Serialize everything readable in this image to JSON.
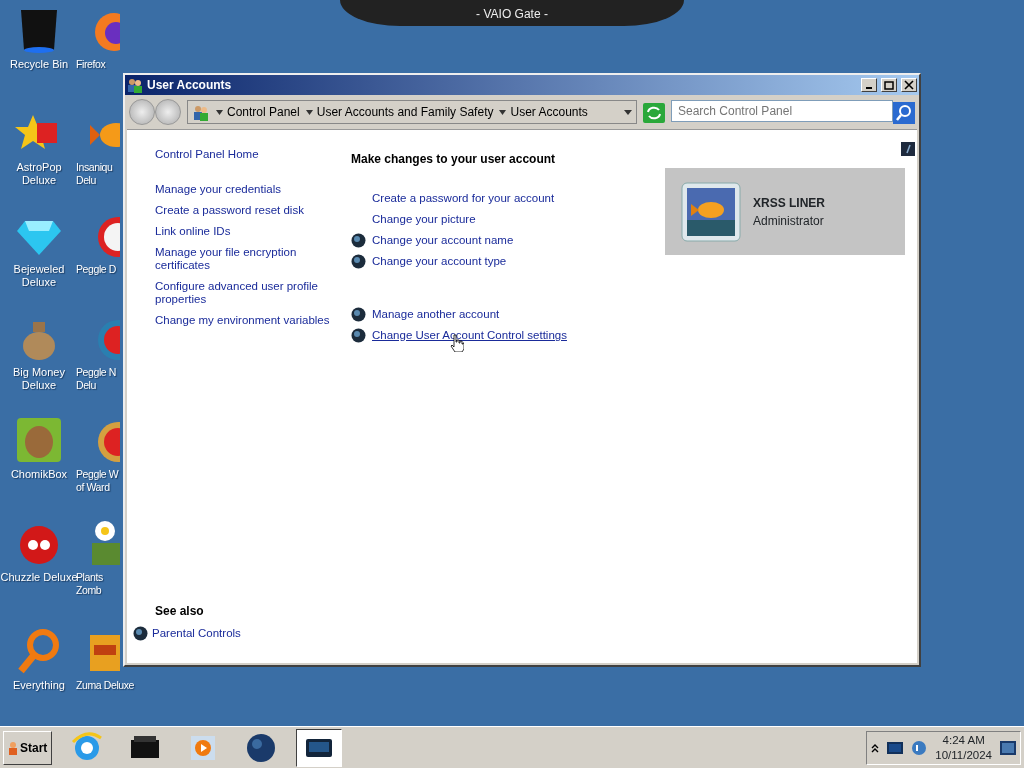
{
  "dock": {
    "title": "- VAIO Gate -"
  },
  "desktop_icons": [
    {
      "lines": [
        "Recycle Bin"
      ]
    },
    {
      "lines": [
        "Firefox"
      ]
    },
    {
      "lines": [
        "AstroPop",
        "Deluxe"
      ]
    },
    {
      "lines": [
        "Insaniqu",
        "Delu"
      ]
    },
    {
      "lines": [
        "Bejeweled",
        "Deluxe"
      ]
    },
    {
      "lines": [
        "Peggle D"
      ]
    },
    {
      "lines": [
        "Big Money",
        "Deluxe"
      ]
    },
    {
      "lines": [
        "Peggle N",
        "Delu"
      ]
    },
    {
      "lines": [
        "ChomikBox"
      ]
    },
    {
      "lines": [
        "Peggle W",
        "of Ward"
      ]
    },
    {
      "lines": [
        "Chuzzle Deluxe"
      ]
    },
    {
      "lines": [
        "Plants",
        "Zomb"
      ]
    },
    {
      "lines": [
        "Everything"
      ]
    },
    {
      "lines": [
        "Zuma Deluxe"
      ]
    }
  ],
  "window": {
    "title": "User Accounts",
    "breadcrumb": [
      "Control Panel",
      "User Accounts and Family Safety",
      "User Accounts"
    ],
    "search": {
      "placeholder": "Search Control Panel"
    },
    "sidebar": {
      "items": [
        "Control Panel Home",
        "Manage your credentials",
        "Create a password reset disk",
        "Link online IDs",
        "Manage your file encryption certificates",
        "Configure advanced user profile properties",
        "Change my environment variables"
      ],
      "see_also": {
        "heading": "See also",
        "links": [
          "Parental Controls"
        ]
      }
    },
    "main": {
      "heading": "Make changes to your user account",
      "links": [
        {
          "text": "Create a password for your account",
          "kind": "plain",
          "hovered": false
        },
        {
          "text": "Change your picture",
          "kind": "plain",
          "hovered": false
        },
        {
          "text": "Change your account name",
          "kind": "shield",
          "hovered": false
        },
        {
          "text": "Change your account type",
          "kind": "shield",
          "hovered": false
        },
        {
          "text": "Manage another account",
          "kind": "shield",
          "hovered": false
        },
        {
          "text": "Change User Account Control settings",
          "kind": "shield",
          "hovered": true
        }
      ]
    },
    "account": {
      "name": "XRSS LINER",
      "role": "Administrator"
    }
  },
  "taskbar": {
    "start": "Start",
    "buttons": [
      {
        "selected": false
      },
      {
        "selected": false
      },
      {
        "selected": false
      },
      {
        "selected": false
      },
      {
        "selected": true
      }
    ],
    "clock": {
      "time": "4:24 AM",
      "date": "10/11/2024"
    }
  }
}
